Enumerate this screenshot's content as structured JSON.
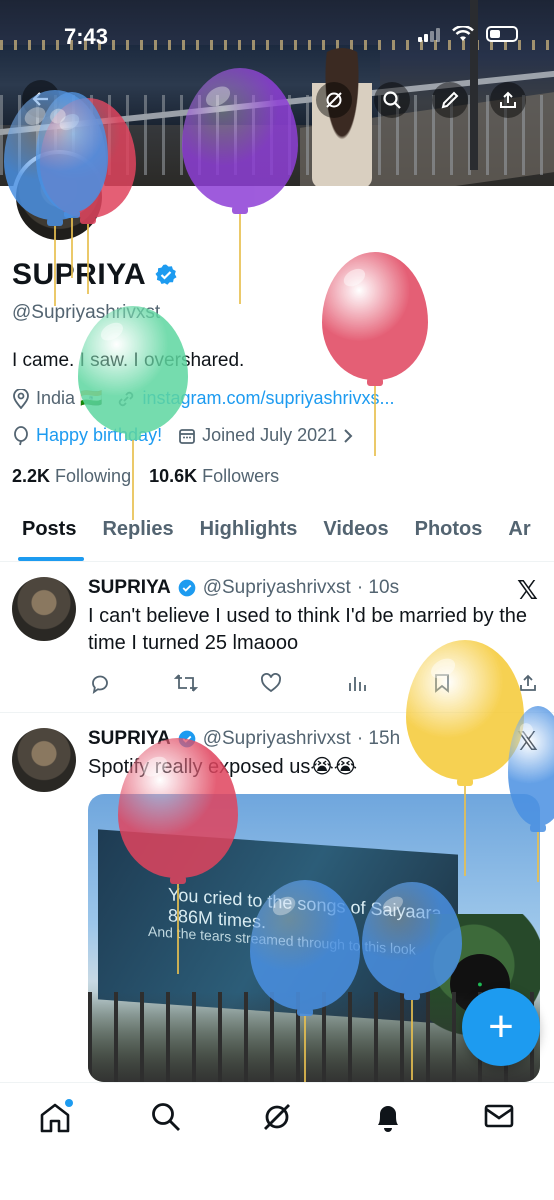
{
  "status_bar": {
    "time": "7:43"
  },
  "profile": {
    "name": "SUPRIYA",
    "handle": "@Supriyashrivxst",
    "bio": "I came. I saw. I overshared.",
    "location": "India 🇮🇳",
    "website": "instagram.com/supriyashrivxs...",
    "birthday": "Happy birthday!",
    "joined": "Joined July 2021",
    "following_count": "2.2K",
    "following_label": "Following",
    "followers_count": "10.6K",
    "followers_label": "Followers"
  },
  "tabs": [
    {
      "label": "Posts",
      "active": true
    },
    {
      "label": "Replies"
    },
    {
      "label": "Highlights"
    },
    {
      "label": "Videos"
    },
    {
      "label": "Photos"
    },
    {
      "label": "Ar"
    }
  ],
  "tweets": [
    {
      "name": "SUPRIYA",
      "handle": "@Supriyashrivxst",
      "time": "· 10s",
      "text": "I can't believe I used to think I'd be married by the time I turned 25 lmaooo"
    },
    {
      "name": "SUPRIYA",
      "handle": "@Supriyashrivxst",
      "time": "· 15h",
      "text": "Spotify really exposed us😭😭",
      "image_text_1": "You cried to the songs of Saiyaara 886M times.",
      "image_text_2": "And the tears streamed through to this look"
    }
  ],
  "fab_label": "+",
  "colors": {
    "accent": "#1d9bf0",
    "balloon_blue": "#4a90e2",
    "balloon_red": "#e0445e",
    "balloon_purple": "#8e3fd6",
    "balloon_green": "#5ed6a0",
    "balloon_yellow": "#f5c934"
  },
  "icons": {
    "banner_actions": [
      "grok-icon",
      "search-icon",
      "edit-icon",
      "share-icon"
    ],
    "bottom_nav": [
      "home-icon",
      "search-icon",
      "grok-icon",
      "bell-icon",
      "mail-icon"
    ]
  }
}
